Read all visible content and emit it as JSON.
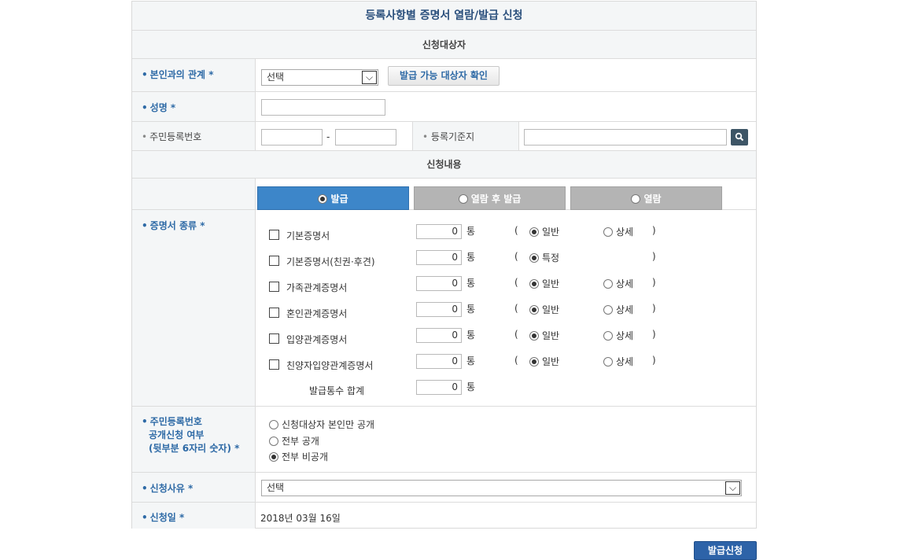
{
  "title": "등록사항별 증명서 열람/발급 신청",
  "sections": {
    "applicant": "신청대상자",
    "request": "신청내용"
  },
  "labels": {
    "relation": "본인과의 관계 *",
    "name": "성명 *",
    "rrn": "주민등록번호",
    "base_address": "등록기준지",
    "cert_type": "증명서 종류 *",
    "rrn_disclose_1": "주민등록번호",
    "rrn_disclose_2": "공개신청 여부",
    "rrn_disclose_3": "(뒷부분 6자리 숫자) *",
    "reason": "신청사유 *",
    "date": "신청일 *"
  },
  "relation_select": {
    "value": "선택"
  },
  "check_button": "발급 가능 대상자 확인",
  "rrn_separator": "-",
  "tabs": [
    {
      "label": "발급",
      "selected": true
    },
    {
      "label": "열람 후 발급",
      "selected": false
    },
    {
      "label": "열람",
      "selected": false
    }
  ],
  "unit": "통",
  "paren_open": "(",
  "paren_close": ")",
  "certificates": [
    {
      "name": "기본증명서",
      "count": "0",
      "opt1": "일반",
      "opt2": "상세",
      "opt1_selected": true
    },
    {
      "name": "기본증명서(친권·후견)",
      "count": "0",
      "opt1": "특정",
      "opt2": "",
      "opt1_selected": true
    },
    {
      "name": "가족관계증명서",
      "count": "0",
      "opt1": "일반",
      "opt2": "상세",
      "opt1_selected": true
    },
    {
      "name": "혼인관계증명서",
      "count": "0",
      "opt1": "일반",
      "opt2": "상세",
      "opt1_selected": true
    },
    {
      "name": "입양관계증명서",
      "count": "0",
      "opt1": "일반",
      "opt2": "상세",
      "opt1_selected": true
    },
    {
      "name": "친양자입양관계증명서",
      "count": "0",
      "opt1": "일반",
      "opt2": "상세",
      "opt1_selected": true
    }
  ],
  "total": {
    "label": "발급통수 합계",
    "count": "0"
  },
  "disclose_options": [
    {
      "label": "신청대상자 본인만 공개",
      "selected": false
    },
    {
      "label": "전부 공개",
      "selected": false
    },
    {
      "label": "전부 비공개",
      "selected": true
    }
  ],
  "reason_select": {
    "value": "선택"
  },
  "date_value": "2018년 03월 16일",
  "submit": "발급신청",
  "icons": {
    "select_arrow": "chevron-down-icon",
    "search": "search-icon"
  },
  "colors": {
    "label_blue": "#2e6aa6",
    "tab_active": "#3d86c9",
    "tab_inactive": "#b4b4b4",
    "submit": "#2d63a8"
  }
}
